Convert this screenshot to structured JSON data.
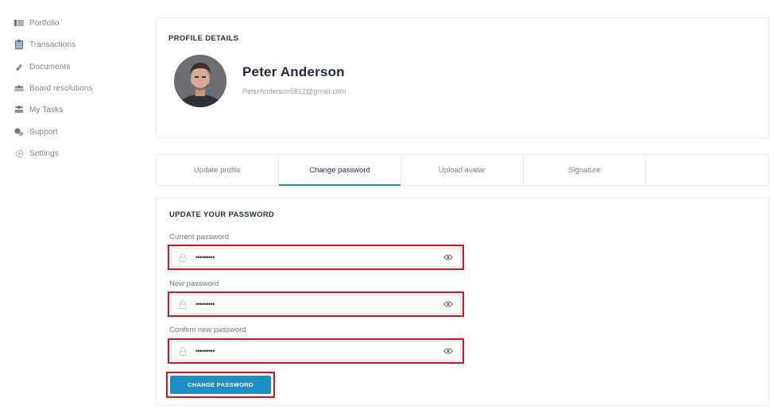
{
  "sidebar": {
    "items": [
      {
        "label": "Portfolio",
        "icon": "portfolio-icon"
      },
      {
        "label": "Transactions",
        "icon": "clipboard-icon"
      },
      {
        "label": "Documents",
        "icon": "documents-icon"
      },
      {
        "label": "Board resolutions",
        "icon": "board-icon"
      },
      {
        "label": "My Tasks",
        "icon": "tasks-icon"
      },
      {
        "label": "Support",
        "icon": "support-icon"
      },
      {
        "label": "Settings",
        "icon": "gear-icon"
      }
    ]
  },
  "profile": {
    "section_title": "PROFILE DETAILS",
    "name": "Peter Anderson",
    "email": "PeterAnderson5812@gmail.com"
  },
  "tabs": [
    {
      "label": "Update profile",
      "active": false
    },
    {
      "label": "Change password",
      "active": true
    },
    {
      "label": "Upload avatar",
      "active": false
    },
    {
      "label": "Signature",
      "active": false
    }
  ],
  "password_form": {
    "title": "UPDATE YOUR PASSWORD",
    "fields": [
      {
        "label": "Current password",
        "value": "•••••••••"
      },
      {
        "label": "New password",
        "value": "•••••••••"
      },
      {
        "label": "Confirm new password",
        "value": "•••••••••"
      }
    ],
    "submit_label": "CHANGE PASSWORD"
  },
  "colors": {
    "accent": "#1d8fc4",
    "highlight": "#e3101c"
  }
}
